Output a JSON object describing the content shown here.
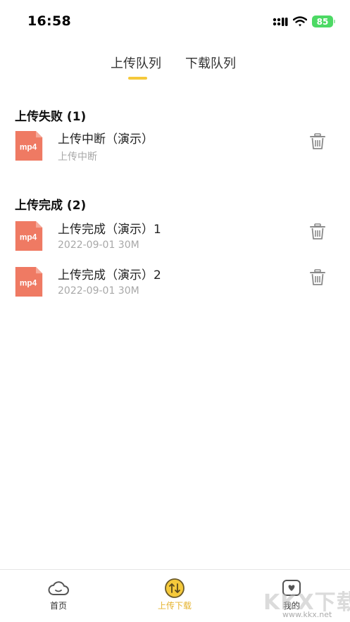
{
  "status_bar": {
    "time": "16:58",
    "battery": "85"
  },
  "tabs": [
    {
      "label": "上传队列"
    },
    {
      "label": "下载队列"
    }
  ],
  "sections": [
    {
      "title": "上传失败 (1)",
      "items": [
        {
          "icon_label": "mp4",
          "name": "上传中断（演示）",
          "subtitle": "上传中断"
        }
      ]
    },
    {
      "title": "上传完成 (2)",
      "items": [
        {
          "icon_label": "mp4",
          "name": "上传完成（演示）1",
          "subtitle": "2022-09-01 30M"
        },
        {
          "icon_label": "mp4",
          "name": "上传完成（演示）2",
          "subtitle": "2022-09-01 30M"
        }
      ]
    }
  ],
  "bottom_nav": [
    {
      "label": "首页",
      "icon": "cloud-icon"
    },
    {
      "label": "上传下载",
      "icon": "transfer-icon",
      "active": true
    },
    {
      "label": "我的",
      "icon": "profile-icon"
    }
  ],
  "watermark": {
    "text": "KKX下载",
    "url": "www.kkx.net"
  },
  "colors": {
    "accent": "#f5c93b",
    "file_icon": "#ef7a63",
    "active_nav": "#e6b32e",
    "battery": "#4cd964"
  }
}
